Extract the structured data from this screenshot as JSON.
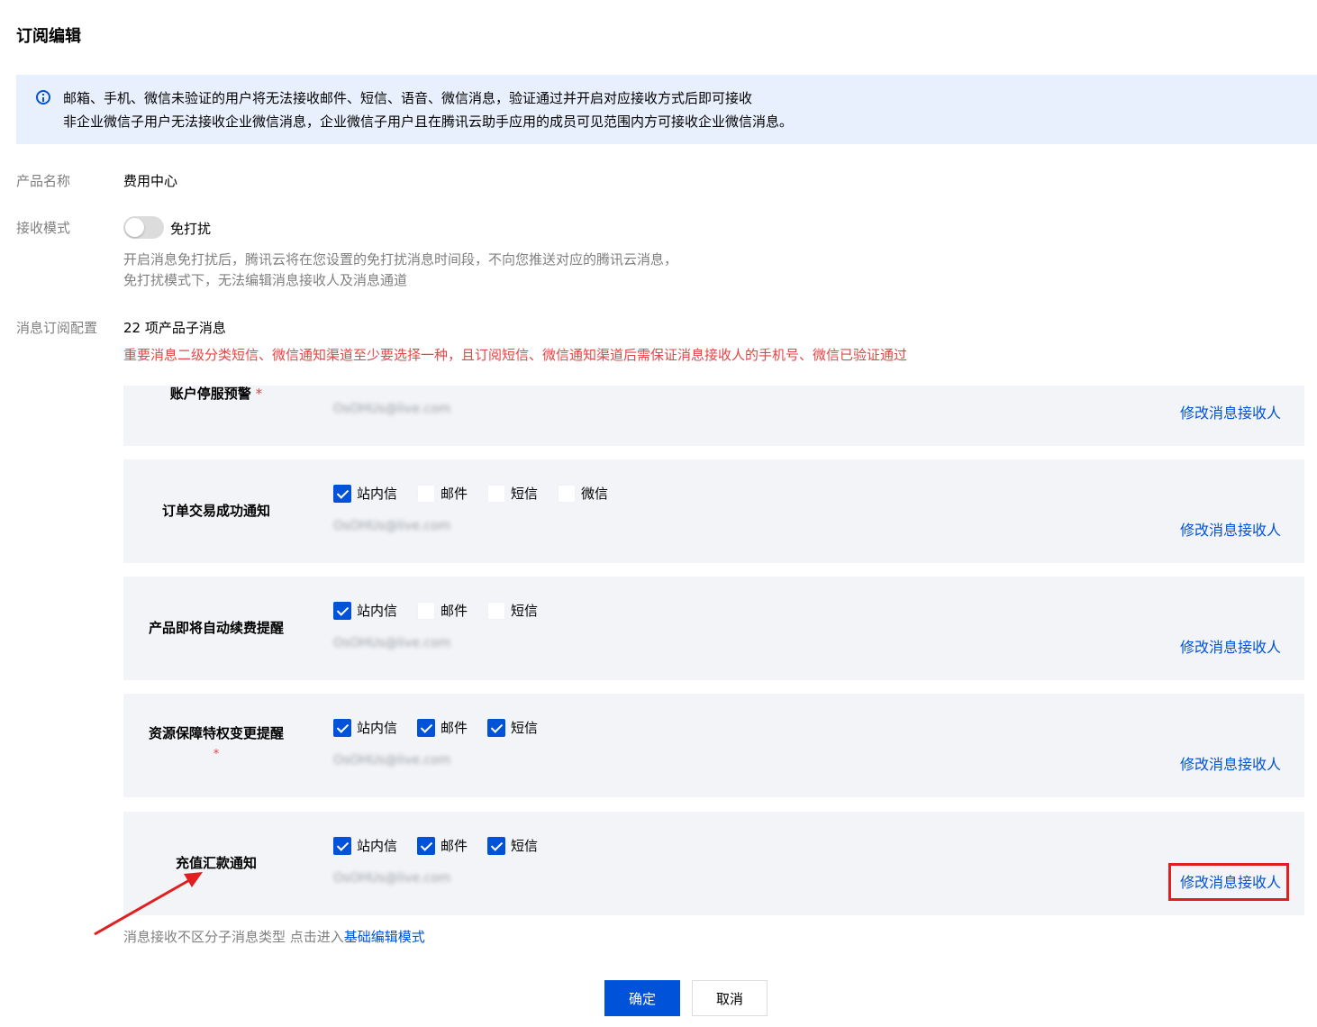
{
  "page": {
    "title": "订阅编辑"
  },
  "notice": {
    "icon": "info-circle-icon",
    "line1": "邮箱、手机、微信未验证的用户将无法接收邮件、短信、语音、微信消息，验证通过并开启对应接收方式后即可接收",
    "line2": "非企业微信子用户无法接收企业微信消息，企业微信子用户且在腾讯云助手应用的成员可见范围内方可接收企业微信消息。"
  },
  "product": {
    "label": "产品名称",
    "value": "费用中心"
  },
  "receive_mode": {
    "label": "接收模式",
    "toggle_on": false,
    "toggle_label": "免打扰",
    "desc_line1": "开启消息免打扰后，腾讯云将在您设置的免打扰消息时间段，不向您推送对应的腾讯云消息，",
    "desc_line2": "免打扰模式下，无法编辑消息接收人及消息通道"
  },
  "subscription": {
    "label": "消息订阅配置",
    "count_text": "22 项产品子消息",
    "warning": "重要消息二级分类短信、微信通知渠道至少要选择一种，且订阅短信、微信通知渠道后需保证消息接收人的手机号、微信已验证通过"
  },
  "cards": [
    {
      "title": "账户停服预警",
      "required": "*",
      "email": "OsOHUs@live.com",
      "edit_label": "修改消息接收人"
    },
    {
      "title": "订单交易成功通知",
      "email": "OsOHUs@live.com",
      "edit_label": "修改消息接收人",
      "channels": [
        {
          "label": "站内信",
          "checked": true
        },
        {
          "label": "邮件",
          "checked": false
        },
        {
          "label": "短信",
          "checked": false
        },
        {
          "label": "微信",
          "checked": false
        }
      ]
    },
    {
      "title": "产品即将自动续费提醒",
      "email": "OsOHUs@live.com",
      "edit_label": "修改消息接收人",
      "channels": [
        {
          "label": "站内信",
          "checked": true
        },
        {
          "label": "邮件",
          "checked": false
        },
        {
          "label": "短信",
          "checked": false
        }
      ]
    },
    {
      "title": "资源保障特权变更提醒",
      "required": "*",
      "email": "OsOHUs@live.com",
      "edit_label": "修改消息接收人",
      "channels": [
        {
          "label": "站内信",
          "checked": true
        },
        {
          "label": "邮件",
          "checked": true
        },
        {
          "label": "短信",
          "checked": true
        }
      ]
    },
    {
      "title": "充值汇款通知",
      "email": "OsOHUs@live.com",
      "edit_label": "修改消息接收人",
      "channels": [
        {
          "label": "站内信",
          "checked": true
        },
        {
          "label": "邮件",
          "checked": true
        },
        {
          "label": "短信",
          "checked": true
        }
      ]
    }
  ],
  "footnote": {
    "text": "消息接收不区分子消息类型 点击进入",
    "link": "基础编辑模式"
  },
  "buttons": {
    "confirm": "确定",
    "cancel": "取消"
  },
  "colors": {
    "primary": "#0052d9",
    "warning": "#e54545",
    "notice_bg": "#e8f0fe",
    "card_bg": "#f3f4f7",
    "annotation": "#e02020"
  }
}
